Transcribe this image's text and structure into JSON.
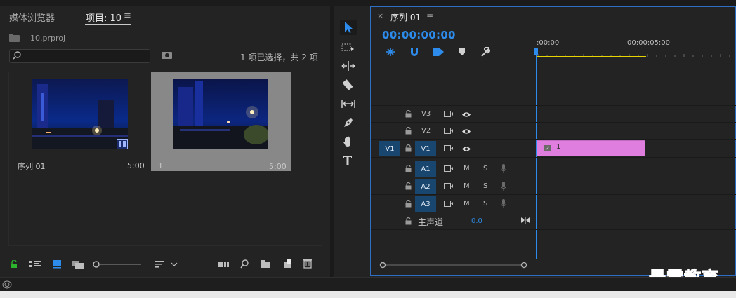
{
  "project_panel": {
    "tab_media_browser": "媒体浏览器",
    "tab_project": "项目: 10",
    "menu_glyph": "≡",
    "project_file": "10.prproj",
    "selection_status": "1 项已选择，共 2 项",
    "items": [
      {
        "name": "序列 01",
        "duration": "5:00"
      },
      {
        "name": "1",
        "duration": "5:00"
      }
    ]
  },
  "timeline": {
    "close_glyph": "×",
    "sequence_title": "序列 01",
    "menu_glyph": "≡",
    "timecode": "00:00:00:00",
    "ruler_start": ":00:00",
    "ruler_5s": "00:00:05:00",
    "video_tracks": [
      {
        "source": "",
        "label": "V3"
      },
      {
        "source": "",
        "label": "V2"
      },
      {
        "source": "V1",
        "label": "V1"
      }
    ],
    "audio_tracks": [
      {
        "label": "A1",
        "m": "M",
        "s": "S"
      },
      {
        "label": "A2",
        "m": "M",
        "s": "S"
      },
      {
        "label": "A3",
        "m": "M",
        "s": "S"
      }
    ],
    "master_label": "主声道",
    "master_value": "0.0",
    "clip_label": "1",
    "clip_color": "#e07ee0",
    "accent_color": "#2d8ceb"
  },
  "watermark": "最需教育"
}
